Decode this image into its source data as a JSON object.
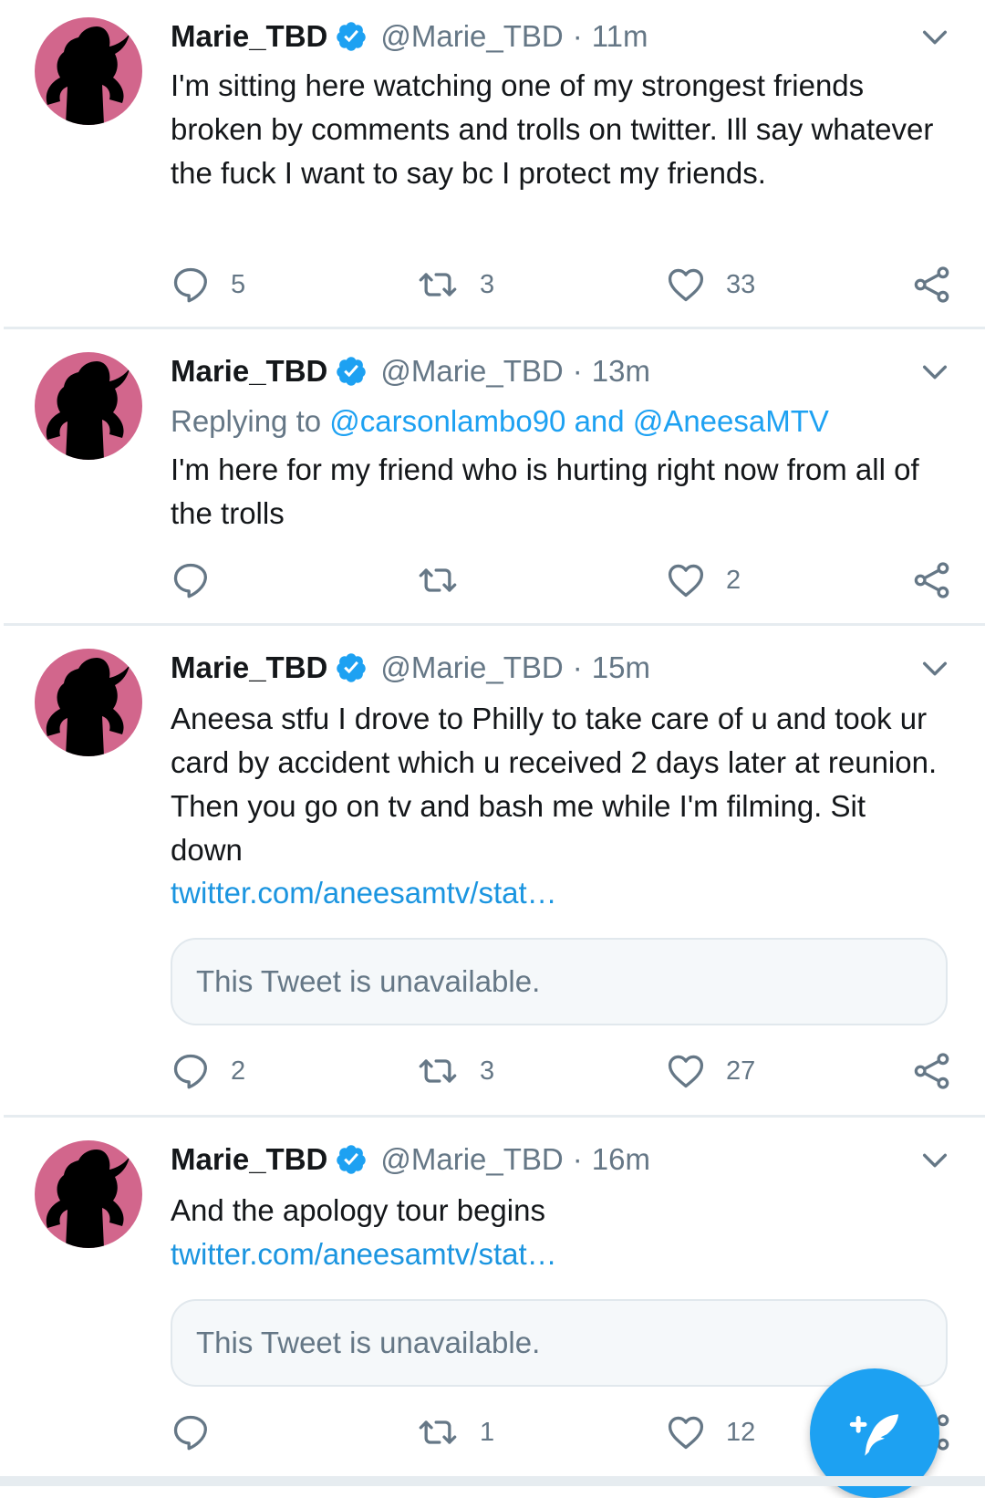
{
  "colors": {
    "accent": "#1da1f2",
    "link": "#1b95e0",
    "avatar_bg": "#d2668c",
    "muted": "#657786"
  },
  "tweets": [
    {
      "name": "Marie_TBD",
      "handle": "@Marie_TBD",
      "separator": "·",
      "time": "11m",
      "text": "I'm sitting here watching one of my strongest friends broken by comments and trolls on twitter. Ill say whatever the fuck I want to say bc I protect my friends.",
      "replies": "5",
      "retweets": "3",
      "likes": "33"
    },
    {
      "name": "Marie_TBD",
      "handle": "@Marie_TBD",
      "separator": "·",
      "time": "13m",
      "replying_prefix": "Replying to ",
      "replying_user1": "@carsonlambo90",
      "replying_and": " and ",
      "replying_user2": "@AneesaMTV",
      "text": "I'm here for my friend who is hurting right now from all of the trolls",
      "replies": "",
      "retweets": "",
      "likes": "2"
    },
    {
      "name": "Marie_TBD",
      "handle": "@Marie_TBD",
      "separator": "·",
      "time": "15m",
      "text": "Aneesa stfu I drove to Philly to take care of u and took ur card by accident which u received 2 days later at reunion. Then you go on tv and bash me while I'm filming. Sit down",
      "link": "twitter.com/aneesamtv/stat…",
      "quote": "This Tweet is unavailable.",
      "replies": "2",
      "retweets": "3",
      "likes": "27"
    },
    {
      "name": "Marie_TBD",
      "handle": "@Marie_TBD",
      "separator": "·",
      "time": "16m",
      "text": "And the apology tour begins",
      "link": "twitter.com/aneesamtv/stat…",
      "quote": "This Tweet is unavailable.",
      "replies": "",
      "retweets": "1",
      "likes": "12"
    }
  ],
  "icons": {
    "verified": "verified-badge-icon",
    "reply": "reply-icon",
    "retweet": "retweet-icon",
    "like": "heart-icon",
    "share": "share-icon",
    "menu": "chevron-down-icon",
    "compose": "compose-tweet-icon"
  }
}
